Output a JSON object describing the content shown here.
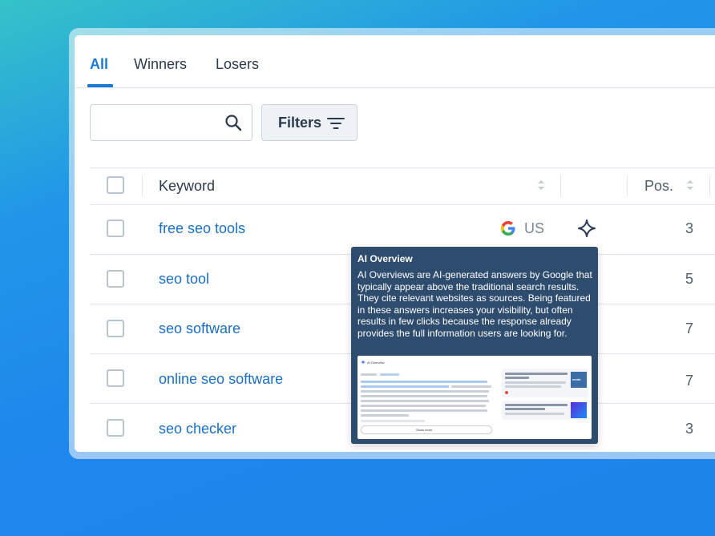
{
  "tabs": [
    {
      "label": "All",
      "active": true
    },
    {
      "label": "Winners",
      "active": false
    },
    {
      "label": "Losers",
      "active": false
    }
  ],
  "search": {
    "value": "",
    "placeholder": ""
  },
  "filters": {
    "label": "Filters"
  },
  "table": {
    "headers": {
      "keyword": "Keyword",
      "position": "Pos."
    },
    "rows": [
      {
        "keyword": "free seo tools",
        "database": "US",
        "ai_overview": true,
        "position": "3"
      },
      {
        "keyword": "seo tool",
        "position": "5"
      },
      {
        "keyword": "seo software",
        "position": "7"
      },
      {
        "keyword": "online seo software",
        "position": "7"
      },
      {
        "keyword": "seo checker",
        "position": "3"
      }
    ]
  },
  "tooltip": {
    "title": "AI Overview",
    "body": "AI Overviews are AI-generated answers by Google that typically appear above the traditional search results. They cite relevant websites as sources. Being featured in these answers increases your visibility, but often results in few clicks because the response already provides the full information users are looking for.",
    "preview": {
      "header": "AI Overview",
      "show_more": "Show more",
      "card1_title": "Seobility Reviews 2025: Details, Pricing, & Features - G2",
      "card2_title": "The 10 Best SEO Marketing Tools of 2025 | TEAM LEWIS Asia",
      "brand": "seobi"
    }
  },
  "colors": {
    "accent": "#1a7ad6",
    "link": "#1a6fc4",
    "tooltip_bg": "#2e4d6e",
    "background": "#1e86ec"
  }
}
